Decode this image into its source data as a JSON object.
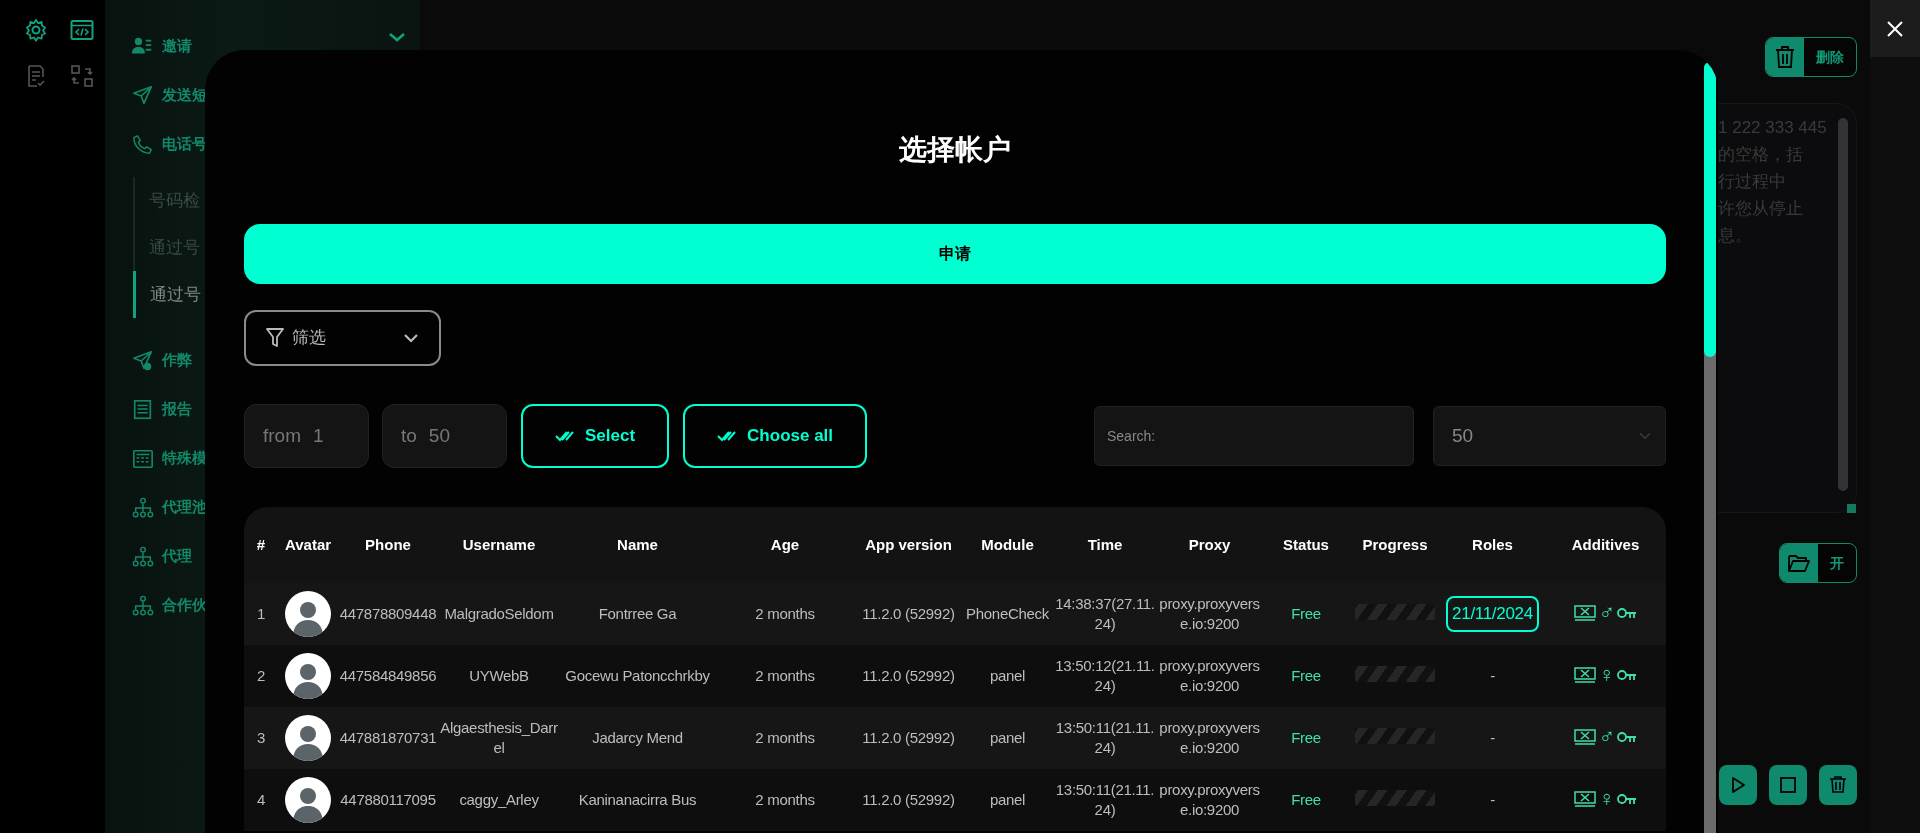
{
  "rail": [
    {
      "active": true
    },
    {
      "active": true
    },
    {
      "active": false
    },
    {
      "active": false
    }
  ],
  "sidebar": {
    "items": [
      {
        "label": "邀请",
        "collapsible": true
      },
      {
        "label": "发送短"
      },
      {
        "label": "电话号",
        "children": [
          {
            "label": "号码检",
            "selected": false
          },
          {
            "label": "通过号",
            "selected": false
          },
          {
            "label": "通过号",
            "selected": true
          }
        ]
      },
      {
        "label": "作弊"
      },
      {
        "label": "报告"
      },
      {
        "label": "特殊模"
      },
      {
        "label": "代理池"
      },
      {
        "label": "代理"
      },
      {
        "label": "合作伙"
      }
    ]
  },
  "right_panel": {
    "delete_button": "删除",
    "message_lines": [
      "1 222 333 445",
      "的空格，括",
      "行过程中",
      "许您从停止",
      "息。"
    ],
    "open_button": "开"
  },
  "modal": {
    "title": "选择帐户",
    "apply_button": "申请",
    "filter": {
      "label": "筛选"
    },
    "range": {
      "from_label": "from",
      "from_value": "1",
      "to_label": "to",
      "to_value": "50"
    },
    "select_button": "Select",
    "choose_all_button": "Choose all",
    "search": {
      "placeholder": "Search:"
    },
    "page_size": "50",
    "table": {
      "columns": [
        "#",
        "Avatar",
        "Phone",
        "Username",
        "Name",
        "Age",
        "App version",
        "Module",
        "Time",
        "Proxy",
        "Status",
        "Progress",
        "Roles",
        "Additives"
      ],
      "rows": [
        {
          "index": "1",
          "phone": "447878809448",
          "username": "MalgradoSeldom",
          "name": "Fontrree Ga",
          "age": "2 months",
          "app_version": "11.2.0 (52992)",
          "module": "PhoneCheck",
          "time": "14:38:37(27.11.24)",
          "proxy": "proxy.proxyverse.io:9200",
          "status": "Free",
          "progress": {
            "level": 0
          },
          "role": "21/11/2024",
          "role_outlined": true,
          "gender": "♂"
        },
        {
          "index": "2",
          "phone": "447584849856",
          "username": "UYWebB",
          "name": "Gocewu Patoncchrkby",
          "age": "2 months",
          "app_version": "11.2.0 (52992)",
          "module": "panel",
          "time": "13:50:12(21.11.24)",
          "proxy": "proxy.proxyverse.io:9200",
          "status": "Free",
          "progress": {
            "level": 0
          },
          "role": "-",
          "role_outlined": false,
          "gender": "♀"
        },
        {
          "index": "3",
          "phone": "447881870731",
          "username": "Algaesthesis_Darrel",
          "name": "Jadarcy Mend",
          "age": "2 months",
          "app_version": "11.2.0 (52992)",
          "module": "panel",
          "time": "13:50:11(21.11.24)",
          "proxy": "proxy.proxyverse.io:9200",
          "status": "Free",
          "progress": {
            "level": 0
          },
          "role": "-",
          "role_outlined": false,
          "gender": "♂"
        },
        {
          "index": "4",
          "phone": "447880117095",
          "username": "caggy_Arley",
          "name": "Kaninanacirra Bus",
          "age": "2 months",
          "app_version": "11.2.0 (52992)",
          "module": "panel",
          "time": "13:50:11(21.11.24)",
          "proxy": "proxy.proxyverse.io:9200",
          "status": "Free",
          "progress": {
            "level": 0
          },
          "role": "-",
          "role_outlined": false,
          "gender": "♀"
        }
      ]
    }
  }
}
